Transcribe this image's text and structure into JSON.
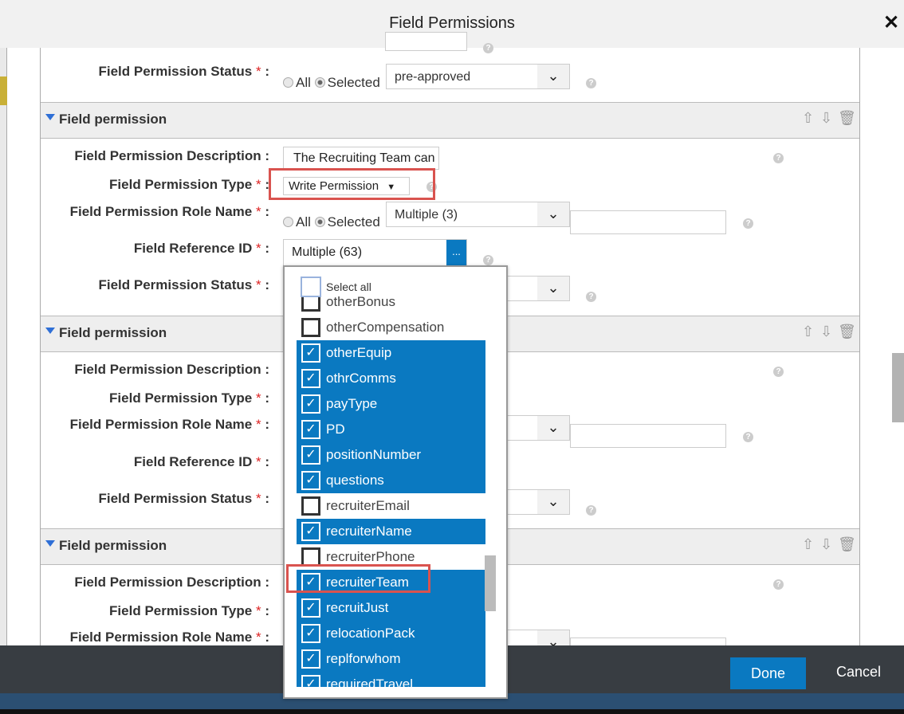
{
  "dialog": {
    "title": "Field Permissions",
    "close_icon": "close-icon"
  },
  "labels": {
    "description": "Field Permission Description",
    "type": "Field Permission Type",
    "role": "Field Permission Role Name",
    "ref": "Field Reference ID",
    "status": "Field Permission Status",
    "required": "*",
    "colon": ":",
    "all": "All",
    "selected": "Selected",
    "help": "?"
  },
  "top_status": {
    "value": "pre-approved"
  },
  "sections": [
    {
      "header": "Field permission",
      "description": "The Recruiting Team can",
      "type": "Write Permission",
      "role": "Multiple (3)",
      "ref": "Multiple (63)",
      "ref_button": "...",
      "status": ""
    },
    {
      "header": "Field permission"
    },
    {
      "header": "Field permission"
    }
  ],
  "multiselect": {
    "select_all": "Select all",
    "items": [
      {
        "label": "otherBonus",
        "checked": false
      },
      {
        "label": "otherCompensation",
        "checked": false
      },
      {
        "label": "otherEquip",
        "checked": true
      },
      {
        "label": "othrComms",
        "checked": true
      },
      {
        "label": "payType",
        "checked": true
      },
      {
        "label": "PD",
        "checked": true
      },
      {
        "label": "positionNumber",
        "checked": true
      },
      {
        "label": "questions",
        "checked": true
      },
      {
        "label": "recruiterEmail",
        "checked": false
      },
      {
        "label": "recruiterName",
        "checked": true
      },
      {
        "label": "recruiterPhone",
        "checked": false
      },
      {
        "label": "recruiterTeam",
        "checked": true
      },
      {
        "label": "recruitJust",
        "checked": true
      },
      {
        "label": "relocationPack",
        "checked": true
      },
      {
        "label": "replforwhom",
        "checked": true
      },
      {
        "label": "requiredTravel",
        "checked": true
      }
    ]
  },
  "footer": {
    "done": "Done",
    "cancel": "Cancel"
  },
  "colors": {
    "accent": "#0a79c1",
    "highlight": "#d9534f",
    "footer": "#383d42"
  }
}
